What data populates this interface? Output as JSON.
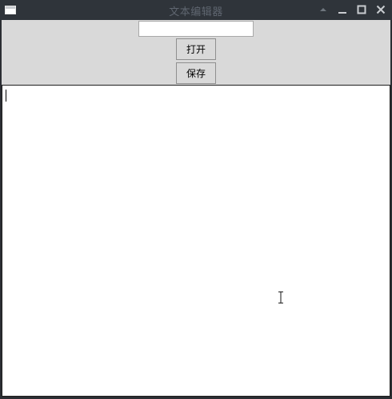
{
  "window": {
    "title": "文本编辑器",
    "controls": {
      "shade_icon": "shade-up-icon",
      "minimize_icon": "minimize-icon",
      "maximize_icon": "maximize-icon",
      "close_icon": "close-icon"
    }
  },
  "toolbar": {
    "filename_input": {
      "value": "",
      "placeholder": ""
    },
    "open_label": "打开",
    "save_label": "保存"
  },
  "editor": {
    "content": ""
  },
  "colors": {
    "titlebar_bg": "#2f343a",
    "titlebar_text": "#5f6670",
    "toolbar_bg": "#d9d9d9",
    "editor_bg": "#ffffff"
  }
}
